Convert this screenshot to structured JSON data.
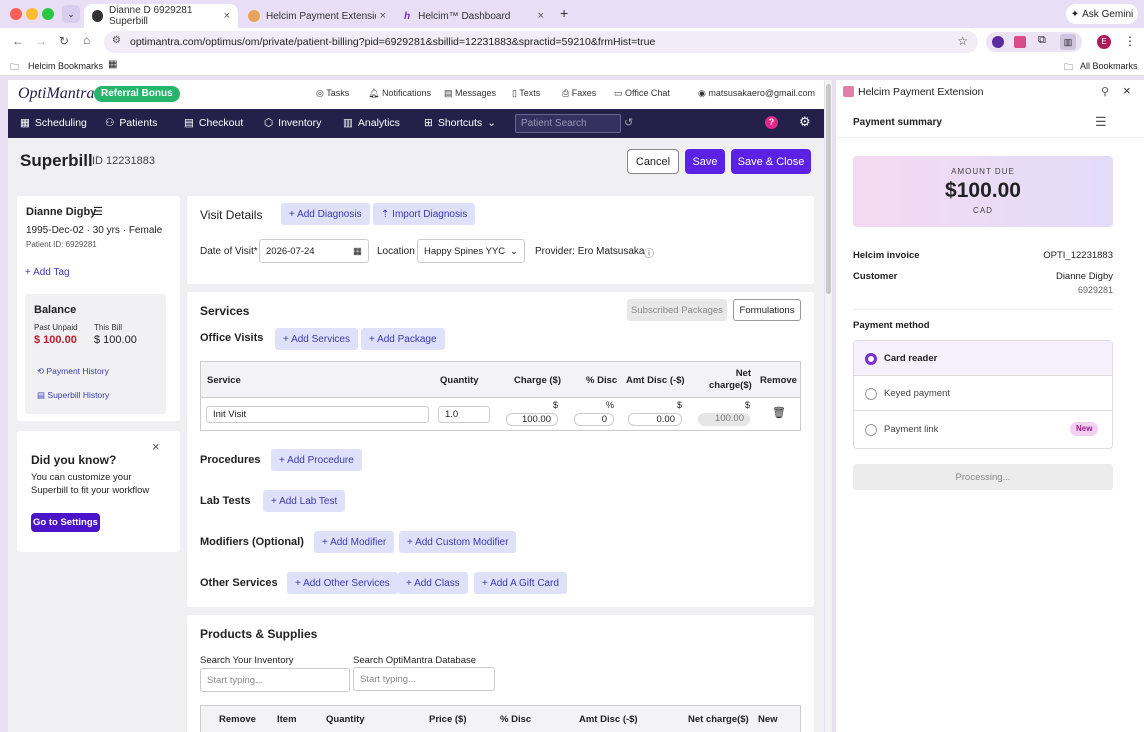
{
  "browser": {
    "tabs": [
      {
        "title": "Dianne D 6929281 Superbill",
        "active": true
      },
      {
        "title": "Helcim Payment Extension - (",
        "active": false
      },
      {
        "title": "Helcim™ Dashboard",
        "active": false
      }
    ],
    "url": "optimantra.com/optimus/om/private/patient-billing?pid=6929281&sbillid=12231883&spractid=59210&frmHist=true",
    "ask_gemini": "Ask Gemini",
    "bookmark": "Helcim Bookmarks",
    "all_bookmarks": "All Bookmarks",
    "profile_initial": "E"
  },
  "app": {
    "logo": "OptiMantra",
    "referral": "Referral Bonus",
    "header_links": [
      "Tasks",
      "Notifications",
      "Messages",
      "Texts",
      "Faxes",
      "Office Chat"
    ],
    "user_email": "matsusakaero@gmail.com",
    "nav": [
      "Scheduling",
      "Patients",
      "Checkout",
      "Inventory",
      "Analytics",
      "Shortcuts"
    ],
    "search_placeholder": "Patient Search",
    "page_title": "Superbill",
    "superbill_id": "ID 12231883",
    "cancel": "Cancel",
    "save": "Save",
    "save_close": "Save & Close"
  },
  "patient": {
    "name": "Dianne Digby",
    "dob_line": "1995-Dec-02 · 30 yrs · Female",
    "patient_id": "Patient ID: 6929281",
    "add_tag": "+ Add Tag",
    "balance_title": "Balance",
    "past_unpaid_label": "Past Unpaid",
    "past_unpaid": "$ 100.00",
    "this_bill_label": "This Bill",
    "this_bill": "$ 100.00",
    "payment_history": "Payment History",
    "superbill_history": "Superbill History"
  },
  "tip": {
    "title": "Did you know?",
    "body": "You can customize your Superbill to fit your workflow",
    "button": "Go to Settings"
  },
  "visit": {
    "title": "Visit Details",
    "add_diagnosis": "+ Add Diagnosis",
    "import_diagnosis": "Import Diagnosis",
    "date_label": "Date of Visit*",
    "date_value": "2026-07-24",
    "location_label": "Location",
    "location_value": "Happy Spines YYC",
    "provider": "Provider: Ero Matsusaka"
  },
  "services": {
    "title": "Services",
    "subscribed": "Subscribed Packages",
    "formulations": "Formulations",
    "office_visits": "Office Visits",
    "add_services": "+ Add Services",
    "add_package": "+ Add Package",
    "columns": [
      "Service",
      "Quantity",
      "Charge ($)",
      "% Disc",
      "Amt Disc (-$)",
      "Net charge($)",
      "Remove"
    ],
    "row": {
      "service": "Init Visit",
      "quantity": "1.0",
      "charge": "100.00",
      "disc": "0",
      "amt_disc": "0.00",
      "net": "100.00"
    },
    "unit_dollar": "$",
    "unit_pct": "%",
    "procedures": "Procedures",
    "add_procedure": "+ Add Procedure",
    "lab_tests": "Lab Tests",
    "add_lab_test": "+ Add Lab Test",
    "modifiers": "Modifiers (Optional)",
    "add_modifier": "+ Add Modifier",
    "add_custom_modifier": "+ Add Custom Modifier",
    "other_services": "Other Services",
    "add_other_services": "+ Add Other Services",
    "add_class": "+ Add Class",
    "add_gift_card": "+ Add A Gift Card"
  },
  "products": {
    "title": "Products & Supplies",
    "search_inventory_label": "Search Your Inventory",
    "search_db_label": "Search OptiMantra Database",
    "placeholder": "Start typing...",
    "columns": [
      "Remove",
      "Item",
      "Quantity",
      "Price ($)",
      "% Disc",
      "Amt Disc (-$)",
      "Net charge($)",
      "New"
    ]
  },
  "helcim": {
    "title": "Helcim Payment Extension",
    "summary": "Payment summary",
    "amount_due_label": "AMOUNT DUE",
    "amount": "$100.00",
    "currency": "CAD",
    "invoice_label": "Helcim invoice",
    "invoice": "OPTI_12231883",
    "customer_label": "Customer",
    "customer": "Dianne Digby",
    "customer_id": "6929281",
    "method_label": "Payment method",
    "methods": [
      "Card reader",
      "Keyed payment",
      "Payment link"
    ],
    "new_badge": "New",
    "processing": "Processing..."
  }
}
